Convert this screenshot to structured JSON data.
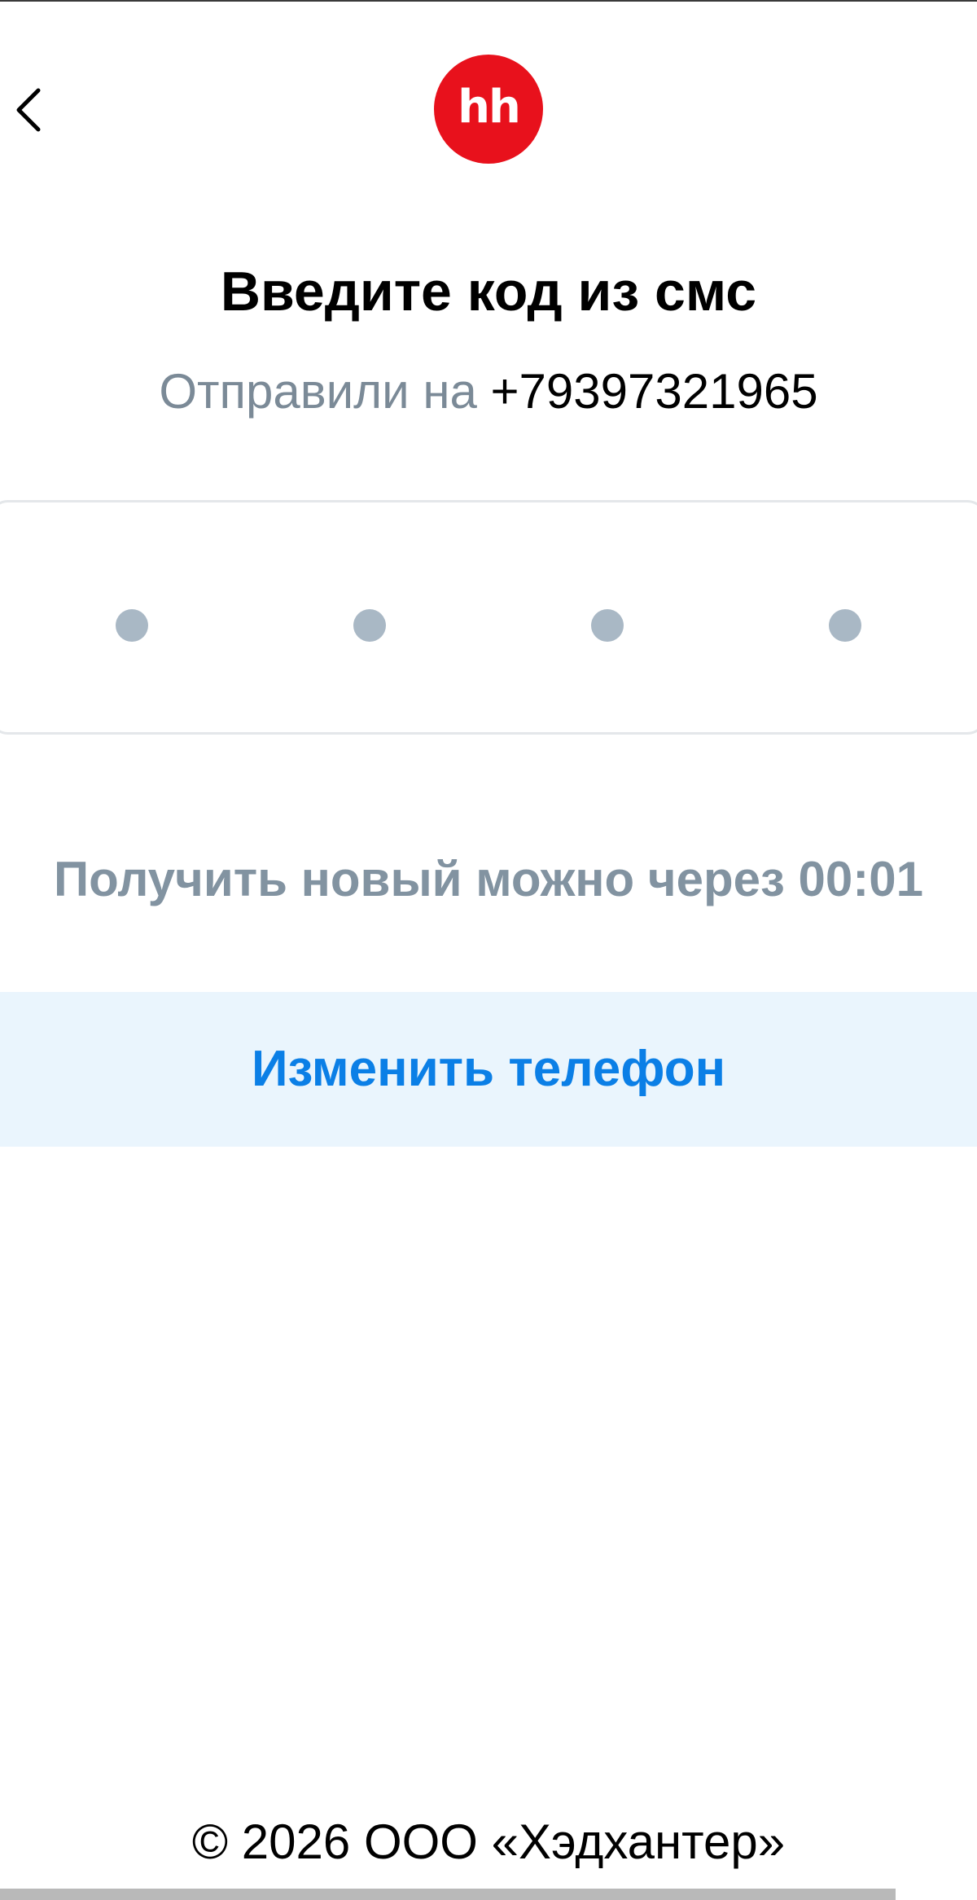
{
  "header": {
    "back_icon": "chevron-left-icon",
    "logo_text": "hh",
    "logo_color": "#e8111c"
  },
  "main": {
    "title": "Введите код из смс",
    "subtitle_prefix": "Отправили на ",
    "phone": "+79397321965",
    "code_input": {
      "length": 4,
      "filled": 0
    },
    "resend_text": "Получить новый можно через 00:01",
    "change_phone_label": "Изменить телефон"
  },
  "footer": {
    "copyright": "© 2026 ООО «Хэдхантер»"
  },
  "colors": {
    "accent": "#0b7fe6",
    "accent_bg": "#eaf5fd",
    "muted_text": "#7b8a97",
    "dot": "#a9b8c5"
  }
}
